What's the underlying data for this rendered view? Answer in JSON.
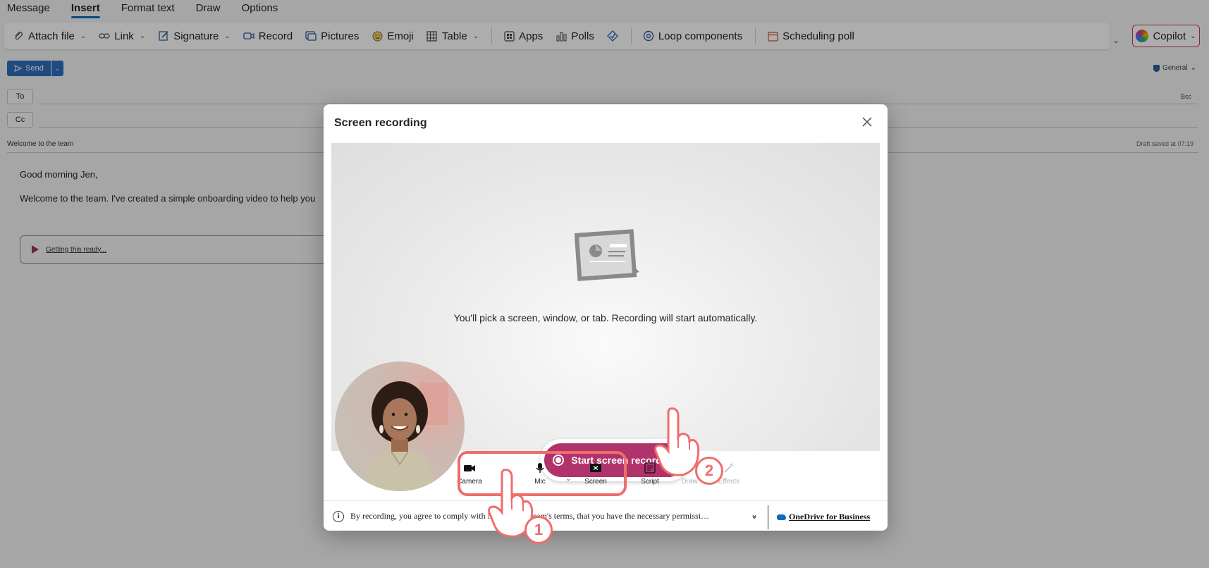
{
  "ribbon": {
    "tabs": [
      {
        "label": "Message",
        "active": false
      },
      {
        "label": "Insert",
        "active": true
      },
      {
        "label": "Format text",
        "active": false
      },
      {
        "label": "Draw",
        "active": false
      },
      {
        "label": "Options",
        "active": false
      }
    ],
    "tools": {
      "attach_file": "Attach file",
      "link": "Link",
      "signature": "Signature",
      "record": "Record",
      "pictures": "Pictures",
      "emoji": "Emoji",
      "table": "Table",
      "apps": "Apps",
      "polls": "Polls",
      "loop_components": "Loop components",
      "scheduling_poll": "Scheduling poll"
    },
    "copilot_label": "Copilot",
    "accent_color": "#0f6cbd"
  },
  "compose": {
    "send_label": "Send",
    "sensitivity_label": "General",
    "to_label": "To",
    "cc_label": "Cc",
    "bcc_label": "Bcc",
    "subject": "Welcome to the team",
    "draft_status": "Draft saved at 07:19",
    "greeting": "Good morning Jen,",
    "body_line": "Welcome to the team. I've created a simple onboarding video to help you",
    "loop_card_text": "Getting this ready..."
  },
  "modal": {
    "title": "Screen recording",
    "preview_message": "You'll pick a screen, window, or tab. Recording will start automatically.",
    "start_button_label": "Start screen recording",
    "start_button_color": "#b0336c",
    "controls": [
      {
        "label": "Camera",
        "icon": "camera-icon",
        "enabled": true
      },
      {
        "label": "Mic",
        "icon": "mic-icon",
        "enabled": true
      },
      {
        "label": "Screen",
        "icon": "screen-icon",
        "enabled": true
      },
      {
        "label": "Script",
        "icon": "script-icon",
        "enabled": true
      },
      {
        "label": "Draw",
        "icon": "draw-icon",
        "enabled": false
      },
      {
        "label": "Effects",
        "icon": "effects-icon",
        "enabled": false
      }
    ],
    "disclaimer": "By recording, you agree to comply with Microsoft Stream's terms, that you have the necessary permissions from all participants.",
    "storage_label": "OneDrive for Business"
  },
  "annotations": {
    "step1": "1",
    "step2": "2",
    "highlight_color": "#ef6d6d"
  }
}
